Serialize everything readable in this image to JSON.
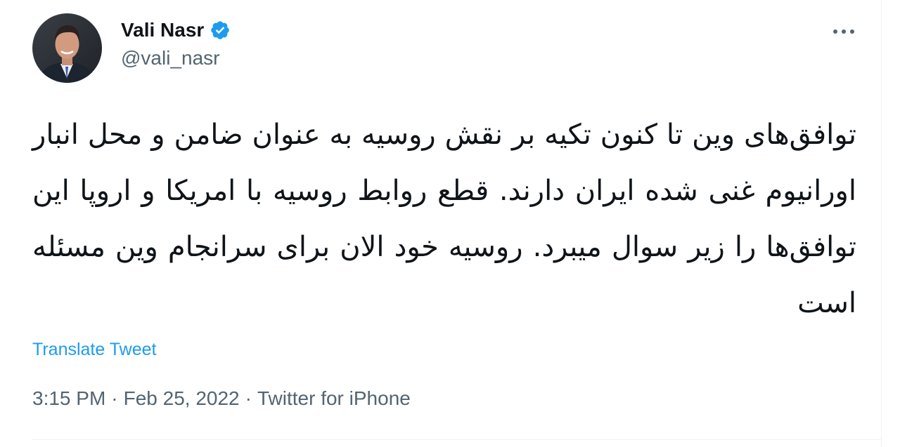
{
  "author": {
    "display_name": "Vali Nasr",
    "handle": "@vali_nasr",
    "verified": true
  },
  "icons": {
    "verified": "verified-badge-icon",
    "more": "more-horizontal-icon"
  },
  "tweet": {
    "text": "توافق‌های وین تا کنون تکیه بر نقش روسیه به عنوان ضامن و محل انبار اورانیوم غنی شده ایران دارند. قطع روابط روسیه با امریکا و اروپا این توافق‌ها را زیر سوال میبرد. روسیه خود الان برای سرانجام وین مسئله است",
    "translate_label": "Translate Tweet"
  },
  "meta": {
    "time": "3:15 PM",
    "separator": "·",
    "date": "Feb 25, 2022",
    "source": "Twitter for iPhone"
  },
  "colors": {
    "link": "#1d9bf0",
    "secondary_text": "#536471",
    "primary_text": "#0f1419",
    "verified_badge": "#1d9bf0"
  }
}
